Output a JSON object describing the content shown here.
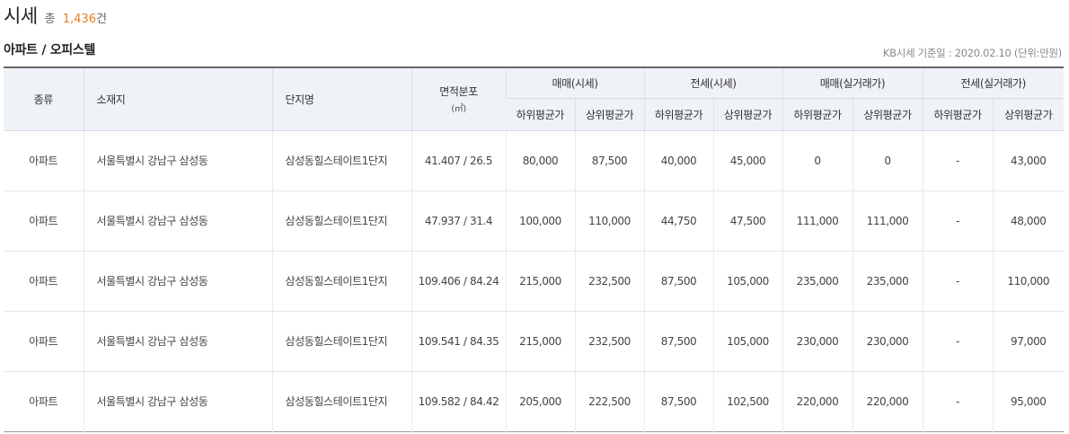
{
  "header": {
    "title": "시세",
    "total_prefix": "총",
    "total_count": "1,436",
    "total_unit": "건"
  },
  "section": {
    "title": "아파트 / 오피스텔",
    "meta": "KB시세 기준일 : 2020.02.10 (단위:만원)"
  },
  "table": {
    "headers": {
      "type": "종류",
      "location": "소재지",
      "complex": "단지명",
      "area": "면적분포",
      "area_unit": "(㎡)",
      "groups": [
        "매매(시세)",
        "전세(시세)",
        "매매(실거래가)",
        "전세(실거래가)"
      ],
      "sub_low": "하위평균가",
      "sub_high": "상위평균가"
    },
    "rows": [
      {
        "type": "아파트",
        "location": "서울특별시 강남구 삼성동",
        "complex": "삼성동힐스테이트1단지",
        "area": "41.407 / 26.5",
        "sale_low": "80,000",
        "sale_high": "87,500",
        "jeonse_low": "40,000",
        "jeonse_high": "45,000",
        "sale_real_low": "0",
        "sale_real_high": "0",
        "jeonse_real_low": "-",
        "jeonse_real_high": "43,000"
      },
      {
        "type": "아파트",
        "location": "서울특별시 강남구 삼성동",
        "complex": "삼성동힐스테이트1단지",
        "area": "47.937 / 31.4",
        "sale_low": "100,000",
        "sale_high": "110,000",
        "jeonse_low": "44,750",
        "jeonse_high": "47,500",
        "sale_real_low": "111,000",
        "sale_real_high": "111,000",
        "jeonse_real_low": "-",
        "jeonse_real_high": "48,000"
      },
      {
        "type": "아파트",
        "location": "서울특별시 강남구 삼성동",
        "complex": "삼성동힐스테이트1단지",
        "area": "109.406 / 84.24",
        "sale_low": "215,000",
        "sale_high": "232,500",
        "jeonse_low": "87,500",
        "jeonse_high": "105,000",
        "sale_real_low": "235,000",
        "sale_real_high": "235,000",
        "jeonse_real_low": "-",
        "jeonse_real_high": "110,000"
      },
      {
        "type": "아파트",
        "location": "서울특별시 강남구 삼성동",
        "complex": "삼성동힐스테이트1단지",
        "area": "109.541 / 84.35",
        "sale_low": "215,000",
        "sale_high": "232,500",
        "jeonse_low": "87,500",
        "jeonse_high": "105,000",
        "sale_real_low": "230,000",
        "sale_real_high": "230,000",
        "jeonse_real_low": "-",
        "jeonse_real_high": "97,000"
      },
      {
        "type": "아파트",
        "location": "서울특별시 강남구 삼성동",
        "complex": "삼성동힐스테이트1단지",
        "area": "109.582 / 84.42",
        "sale_low": "205,000",
        "sale_high": "222,500",
        "jeonse_low": "87,500",
        "jeonse_high": "102,500",
        "sale_real_low": "220,000",
        "sale_real_high": "220,000",
        "jeonse_real_low": "-",
        "jeonse_real_high": "95,000"
      }
    ]
  }
}
